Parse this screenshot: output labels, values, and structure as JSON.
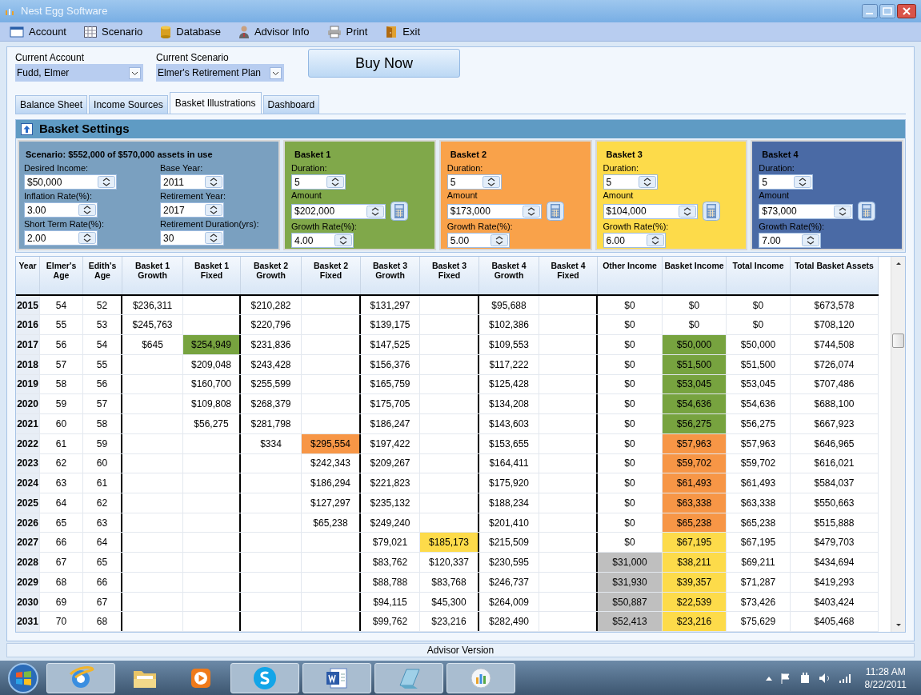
{
  "window": {
    "title": "Nest Egg Software"
  },
  "menu": [
    {
      "label": "Account",
      "kind": "account"
    },
    {
      "label": "Scenario",
      "kind": "scenario"
    },
    {
      "label": "Database",
      "kind": "database"
    },
    {
      "label": "Advisor Info",
      "kind": "advisor"
    },
    {
      "label": "Print",
      "kind": "print"
    },
    {
      "label": "Exit",
      "kind": "exit"
    }
  ],
  "selectors": [
    {
      "label": "Current Account",
      "value": "Fudd, Elmer"
    },
    {
      "label": "Current Scenario",
      "value": "Elmer's Retirement Plan"
    }
  ],
  "buy_button": "Buy Now",
  "tabs": [
    {
      "label": "Balance Sheet",
      "selected": false
    },
    {
      "label": "Income Sources",
      "selected": false
    },
    {
      "label": "Basket Illustrations",
      "selected": true
    },
    {
      "label": "Dashboard",
      "selected": false
    }
  ],
  "basket_settings": {
    "title": "Basket Settings",
    "scenario": {
      "summary": "Scenario: $552,000 of $570,000 assets in use",
      "fields": [
        {
          "label": "Desired Income:",
          "value": "$50,000"
        },
        {
          "label": "Base Year:",
          "value": "2011"
        },
        {
          "label": "Inflation Rate(%):",
          "value": "3.00"
        },
        {
          "label": "Retirement Year:",
          "value": "2017"
        },
        {
          "label": "Short Term Rate(%):",
          "value": "2.00"
        },
        {
          "label": "Retirement Duration(yrs):",
          "value": "30"
        }
      ]
    },
    "baskets": [
      {
        "name": "Basket 1",
        "color": "#80a84a",
        "fields": [
          {
            "label": "Duration:",
            "value": "5",
            "calculator": false
          },
          {
            "label": "Amount",
            "value": "$202,000",
            "calculator": true
          },
          {
            "label": "Growth Rate(%):",
            "value": "4.00",
            "calculator": false
          }
        ]
      },
      {
        "name": "Basket 2",
        "color": "#f9a24a",
        "fields": [
          {
            "label": "Duration:",
            "value": "5",
            "calculator": false
          },
          {
            "label": "Amount",
            "value": "$173,000",
            "calculator": true
          },
          {
            "label": "Growth Rate(%):",
            "value": "5.00",
            "calculator": false
          }
        ]
      },
      {
        "name": "Basket 3",
        "color": "#fddb4a",
        "fields": [
          {
            "label": "Duration:",
            "value": "5",
            "calculator": false
          },
          {
            "label": "Amount",
            "value": "$104,000",
            "calculator": true
          },
          {
            "label": "Growth Rate(%):",
            "value": "6.00",
            "calculator": false
          }
        ]
      },
      {
        "name": "Basket 4",
        "color": "#4a6aa5",
        "fields": [
          {
            "label": "Duration:",
            "value": "5",
            "calculator": false
          },
          {
            "label": "Amount",
            "value": "$73,000",
            "calculator": true
          },
          {
            "label": "Growth Rate(%):",
            "value": "7.00",
            "calculator": false
          }
        ]
      }
    ]
  },
  "table": {
    "columns": [
      "Year",
      "Elmer's Age",
      "Edith's Age",
      "Basket 1 Growth",
      "Basket 1 Fixed",
      "Basket 2 Growth",
      "Basket 2 Fixed",
      "Basket 3 Growth",
      "Basket 3 Fixed",
      "Basket 4 Growth",
      "Basket 4 Fixed",
      "Other Income",
      "Basket Income",
      "Total Income",
      "Total Basket Assets"
    ],
    "rows": [
      {
        "cells": [
          {
            "text": "2015"
          },
          {
            "text": "54"
          },
          {
            "text": "52"
          },
          {
            "text": "$236,311"
          },
          {},
          {
            "text": "$210,282"
          },
          {},
          {
            "text": "$131,297"
          },
          {},
          {
            "text": "$95,688"
          },
          {},
          {
            "text": "$0"
          },
          {
            "text": "$0"
          },
          {
            "text": "$0"
          },
          {
            "text": "$673,578"
          }
        ]
      },
      {
        "cells": [
          {
            "text": "2016"
          },
          {
            "text": "55"
          },
          {
            "text": "53"
          },
          {
            "text": "$245,763"
          },
          {},
          {
            "text": "$220,796"
          },
          {},
          {
            "text": "$139,175"
          },
          {},
          {
            "text": "$102,386"
          },
          {},
          {
            "text": "$0"
          },
          {
            "text": "$0"
          },
          {
            "text": "$0"
          },
          {
            "text": "$708,120"
          }
        ]
      },
      {
        "cells": [
          {
            "text": "2017"
          },
          {
            "text": "56"
          },
          {
            "text": "54"
          },
          {
            "text": "$645"
          },
          {
            "text": "$254,949",
            "color": "#77a33f"
          },
          {
            "text": "$231,836"
          },
          {},
          {
            "text": "$147,525"
          },
          {},
          {
            "text": "$109,553"
          },
          {},
          {
            "text": "$0"
          },
          {
            "text": "$50,000",
            "color": "#77a33f"
          },
          {
            "text": "$50,000"
          },
          {
            "text": "$744,508"
          }
        ]
      },
      {
        "cells": [
          {
            "text": "2018"
          },
          {
            "text": "57"
          },
          {
            "text": "55"
          },
          {},
          {
            "text": "$209,048"
          },
          {
            "text": "$243,428"
          },
          {},
          {
            "text": "$156,376"
          },
          {},
          {
            "text": "$117,222"
          },
          {},
          {
            "text": "$0"
          },
          {
            "text": "$51,500",
            "color": "#77a33f"
          },
          {
            "text": "$51,500"
          },
          {
            "text": "$726,074"
          }
        ]
      },
      {
        "cells": [
          {
            "text": "2019"
          },
          {
            "text": "58"
          },
          {
            "text": "56"
          },
          {},
          {
            "text": "$160,700"
          },
          {
            "text": "$255,599"
          },
          {},
          {
            "text": "$165,759"
          },
          {},
          {
            "text": "$125,428"
          },
          {},
          {
            "text": "$0"
          },
          {
            "text": "$53,045",
            "color": "#77a33f"
          },
          {
            "text": "$53,045"
          },
          {
            "text": "$707,486"
          }
        ]
      },
      {
        "cells": [
          {
            "text": "2020"
          },
          {
            "text": "59"
          },
          {
            "text": "57"
          },
          {},
          {
            "text": "$109,808"
          },
          {
            "text": "$268,379"
          },
          {},
          {
            "text": "$175,705"
          },
          {},
          {
            "text": "$134,208"
          },
          {},
          {
            "text": "$0"
          },
          {
            "text": "$54,636",
            "color": "#77a33f"
          },
          {
            "text": "$54,636"
          },
          {
            "text": "$688,100"
          }
        ]
      },
      {
        "cells": [
          {
            "text": "2021"
          },
          {
            "text": "60"
          },
          {
            "text": "58"
          },
          {},
          {
            "text": "$56,275"
          },
          {
            "text": "$281,798"
          },
          {},
          {
            "text": "$186,247"
          },
          {},
          {
            "text": "$143,603"
          },
          {},
          {
            "text": "$0"
          },
          {
            "text": "$56,275",
            "color": "#77a33f"
          },
          {
            "text": "$56,275"
          },
          {
            "text": "$667,923"
          }
        ]
      },
      {
        "cells": [
          {
            "text": "2022"
          },
          {
            "text": "61"
          },
          {
            "text": "59"
          },
          {},
          {},
          {
            "text": "$334"
          },
          {
            "text": "$295,554",
            "color": "#f79646"
          },
          {
            "text": "$197,422"
          },
          {},
          {
            "text": "$153,655"
          },
          {},
          {
            "text": "$0"
          },
          {
            "text": "$57,963",
            "color": "#f79646"
          },
          {
            "text": "$57,963"
          },
          {
            "text": "$646,965"
          }
        ]
      },
      {
        "cells": [
          {
            "text": "2023"
          },
          {
            "text": "62"
          },
          {
            "text": "60"
          },
          {},
          {},
          {},
          {
            "text": "$242,343"
          },
          {
            "text": "$209,267"
          },
          {},
          {
            "text": "$164,411"
          },
          {},
          {
            "text": "$0"
          },
          {
            "text": "$59,702",
            "color": "#f79646"
          },
          {
            "text": "$59,702"
          },
          {
            "text": "$616,021"
          }
        ]
      },
      {
        "cells": [
          {
            "text": "2024"
          },
          {
            "text": "63"
          },
          {
            "text": "61"
          },
          {},
          {},
          {},
          {
            "text": "$186,294"
          },
          {
            "text": "$221,823"
          },
          {},
          {
            "text": "$175,920"
          },
          {},
          {
            "text": "$0"
          },
          {
            "text": "$61,493",
            "color": "#f79646"
          },
          {
            "text": "$61,493"
          },
          {
            "text": "$584,037"
          }
        ]
      },
      {
        "cells": [
          {
            "text": "2025"
          },
          {
            "text": "64"
          },
          {
            "text": "62"
          },
          {},
          {},
          {},
          {
            "text": "$127,297"
          },
          {
            "text": "$235,132"
          },
          {},
          {
            "text": "$188,234"
          },
          {},
          {
            "text": "$0"
          },
          {
            "text": "$63,338",
            "color": "#f79646"
          },
          {
            "text": "$63,338"
          },
          {
            "text": "$550,663"
          }
        ]
      },
      {
        "cells": [
          {
            "text": "2026"
          },
          {
            "text": "65"
          },
          {
            "text": "63"
          },
          {},
          {},
          {},
          {
            "text": "$65,238"
          },
          {
            "text": "$249,240"
          },
          {},
          {
            "text": "$201,410"
          },
          {},
          {
            "text": "$0"
          },
          {
            "text": "$65,238",
            "color": "#f79646"
          },
          {
            "text": "$65,238"
          },
          {
            "text": "$515,888"
          }
        ]
      },
      {
        "cells": [
          {
            "text": "2027"
          },
          {
            "text": "66"
          },
          {
            "text": "64"
          },
          {},
          {},
          {},
          {},
          {
            "text": "$79,021"
          },
          {
            "text": "$185,173",
            "color": "#fddb4a"
          },
          {
            "text": "$215,509"
          },
          {},
          {
            "text": "$0"
          },
          {
            "text": "$67,195",
            "color": "#fddb4a"
          },
          {
            "text": "$67,195"
          },
          {
            "text": "$479,703"
          }
        ]
      },
      {
        "cells": [
          {
            "text": "2028"
          },
          {
            "text": "67"
          },
          {
            "text": "65"
          },
          {},
          {},
          {},
          {},
          {
            "text": "$83,762"
          },
          {
            "text": "$120,337"
          },
          {
            "text": "$230,595"
          },
          {},
          {
            "text": "$31,000",
            "color": "#bfbfbf"
          },
          {
            "text": "$38,211",
            "color": "#fddb4a"
          },
          {
            "text": "$69,211"
          },
          {
            "text": "$434,694"
          }
        ]
      },
      {
        "cells": [
          {
            "text": "2029"
          },
          {
            "text": "68"
          },
          {
            "text": "66"
          },
          {},
          {},
          {},
          {},
          {
            "text": "$88,788"
          },
          {
            "text": "$83,768"
          },
          {
            "text": "$246,737"
          },
          {},
          {
            "text": "$31,930",
            "color": "#bfbfbf"
          },
          {
            "text": "$39,357",
            "color": "#fddb4a"
          },
          {
            "text": "$71,287"
          },
          {
            "text": "$419,293"
          }
        ]
      },
      {
        "cells": [
          {
            "text": "2030"
          },
          {
            "text": "69"
          },
          {
            "text": "67"
          },
          {},
          {},
          {},
          {},
          {
            "text": "$94,115"
          },
          {
            "text": "$45,300"
          },
          {
            "text": "$264,009"
          },
          {},
          {
            "text": "$50,887",
            "color": "#bfbfbf"
          },
          {
            "text": "$22,539",
            "color": "#fddb4a"
          },
          {
            "text": "$73,426"
          },
          {
            "text": "$403,424"
          }
        ]
      },
      {
        "cells": [
          {
            "text": "2031"
          },
          {
            "text": "70"
          },
          {
            "text": "68"
          },
          {},
          {},
          {},
          {},
          {
            "text": "$99,762"
          },
          {
            "text": "$23,216"
          },
          {
            "text": "$282,490"
          },
          {},
          {
            "text": "$52,413",
            "color": "#bfbfbf"
          },
          {
            "text": "$23,216",
            "color": "#fddb4a"
          },
          {
            "text": "$75,629"
          },
          {
            "text": "$405,468"
          }
        ]
      }
    ]
  },
  "status_bar": "Advisor Version",
  "taskbar": {
    "apps": [
      {
        "kind": "browser",
        "selected": true
      },
      {
        "kind": "folder",
        "selected": false
      },
      {
        "kind": "media",
        "selected": false
      },
      {
        "kind": "chat",
        "selected": true
      },
      {
        "kind": "document",
        "selected": true
      },
      {
        "kind": "notes",
        "selected": true
      },
      {
        "kind": "chart",
        "selected": true
      }
    ],
    "time": "11:28 AM",
    "date": "8/22/2011"
  }
}
